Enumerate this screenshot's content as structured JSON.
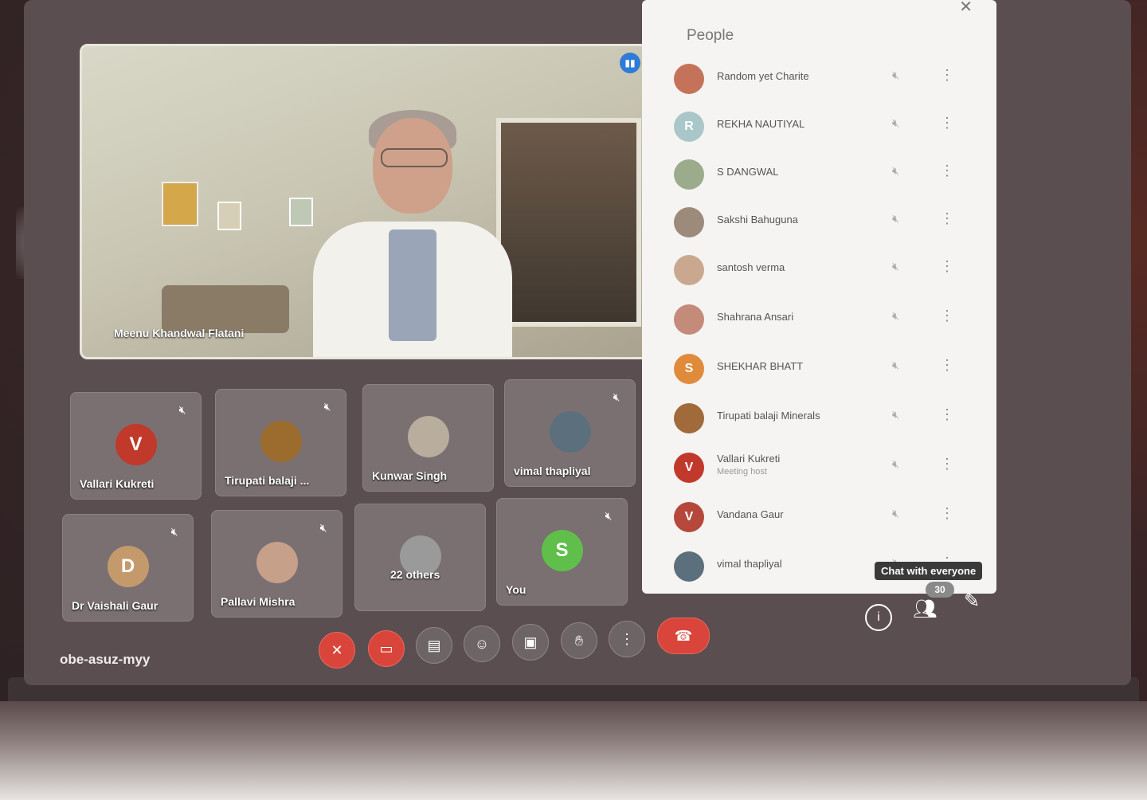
{
  "meeting": {
    "code": "obe-asuz-myy",
    "spotlight_name": "Meenu Khandwal Flatani"
  },
  "tiles": [
    {
      "name": "Vallari Kukreti",
      "avatar_letter": "V",
      "avatar_color": "#c0392b",
      "muted": true
    },
    {
      "name": "Tirupati balaji ...",
      "avatar_letter": "",
      "avatar_color": "#9c6c2e",
      "muted": true
    },
    {
      "name": "Kunwar Singh",
      "avatar_letter": "",
      "avatar_color": "#b9ad9d",
      "muted": false
    },
    {
      "name": "vimal thapliyal",
      "avatar_letter": "",
      "avatar_color": "#5c6f7d",
      "muted": true
    },
    {
      "name": "Dr Vaishali Gaur",
      "avatar_letter": "D",
      "avatar_color": "#c49a6c",
      "muted": true
    },
    {
      "name": "Pallavi Mishra",
      "avatar_letter": "",
      "avatar_color": "#c7a08a",
      "muted": true
    },
    {
      "name": "22 others",
      "avatar_letter": "",
      "avatar_color": "#9a9a9a",
      "muted": false
    },
    {
      "name": "You",
      "avatar_letter": "S",
      "avatar_color": "#5fbf4a",
      "muted": true
    }
  ],
  "controls": {
    "mic_icon": "mic-off-icon",
    "camera_icon": "camera-off-icon",
    "captions_icon": "captions-icon",
    "emoji_icon": "emoji-icon",
    "present_icon": "present-icon",
    "hand_icon": "raise-hand-icon",
    "more_icon": "more-vert-icon",
    "end_icon": "end-call-icon"
  },
  "people_panel": {
    "title": "People",
    "close_icon": "close-icon",
    "participants": [
      {
        "name": "Random yet Charite",
        "sub": "",
        "avatar_letter": "",
        "avatar_color": "#c4735a"
      },
      {
        "name": "REKHA NAUTIYAL",
        "sub": "",
        "avatar_letter": "R",
        "avatar_color": "#a9c7c8"
      },
      {
        "name": "S DANGWAL",
        "sub": "",
        "avatar_letter": "",
        "avatar_color": "#9bab8c"
      },
      {
        "name": "Sakshi Bahuguna",
        "sub": "",
        "avatar_letter": "",
        "avatar_color": "#9c8a7a"
      },
      {
        "name": "santosh verma",
        "sub": "",
        "avatar_letter": "",
        "avatar_color": "#caa88f"
      },
      {
        "name": "Shahrana Ansari",
        "sub": "",
        "avatar_letter": "",
        "avatar_color": "#c48a7a"
      },
      {
        "name": "SHEKHAR BHATT",
        "sub": "",
        "avatar_letter": "S",
        "avatar_color": "#e08b3c"
      },
      {
        "name": "Tirupati balaji Minerals",
        "sub": "",
        "avatar_letter": "",
        "avatar_color": "#a06a3a"
      },
      {
        "name": "Vallari Kukreti",
        "sub": "Meeting host",
        "avatar_letter": "V",
        "avatar_color": "#c0392b"
      },
      {
        "name": "Vandana Gaur",
        "sub": "",
        "avatar_letter": "V",
        "avatar_color": "#b5483a"
      },
      {
        "name": "vimal thapliyal",
        "sub": "",
        "avatar_letter": "",
        "avatar_color": "#5c6f7d"
      }
    ]
  },
  "side_controls": {
    "chat_label": "Chat with everyone",
    "people_count": "30",
    "info_icon": "info-icon",
    "people_icon": "people-icon",
    "activities_icon": "activities-icon"
  }
}
